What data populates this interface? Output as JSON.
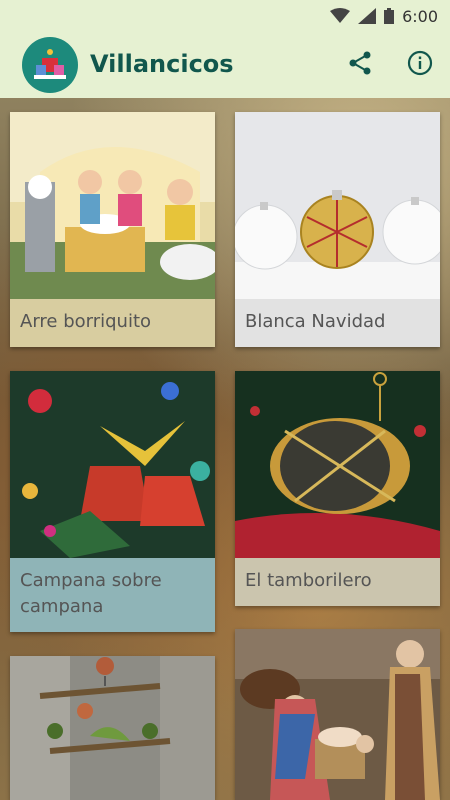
{
  "status_bar": {
    "time": "6:00"
  },
  "app_bar": {
    "title": "Villancicos",
    "share_icon": "share-icon",
    "info_icon": "info-icon"
  },
  "songs": [
    {
      "title": "Arre borriquito",
      "label_color": "#d8cda0"
    },
    {
      "title": "Blanca Navidad",
      "label_color": "#e2e2e2"
    },
    {
      "title": "Campana sobre campana",
      "label_color": "#8fb4b7"
    },
    {
      "title": "El tamborilero",
      "label_color": "#cbc5ae"
    }
  ]
}
